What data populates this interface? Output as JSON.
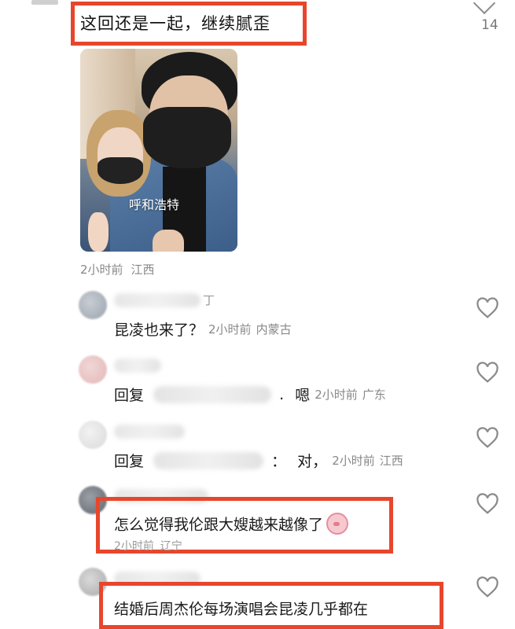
{
  "top_comment": {
    "text": "这回还是一起，继续腻歪",
    "like_count": "14",
    "photo_caption": "呼和浩特",
    "time": "2小时前",
    "location": "江西"
  },
  "replies": [
    {
      "prefix": "",
      "name_hint": "丁",
      "separator": "",
      "text": "昆凌也来了？",
      "time": "2小时前",
      "location": "内蒙古"
    },
    {
      "prefix": "回复",
      "separator": ".",
      "text": "嗯",
      "time": "2小时前",
      "location": "广东"
    },
    {
      "prefix": "回复",
      "separator": "：",
      "text": "对，",
      "time": "2小时前",
      "location": "江西"
    },
    {
      "prefix": "",
      "separator": "",
      "text": "怎么觉得我伦跟大嫂越来越像了",
      "time": "2小时前",
      "location": "辽宁"
    },
    {
      "prefix": "",
      "separator": "",
      "text": "结婚后周杰伦每场演唱会昆凌几乎都在",
      "time": "",
      "location": ""
    }
  ],
  "colors": {
    "highlight": "#e8462c",
    "meta": "#888888",
    "heart": "#8a8a8a"
  },
  "icons": [
    "chevron-down-icon",
    "heart-icon",
    "pig-emoji-icon"
  ]
}
